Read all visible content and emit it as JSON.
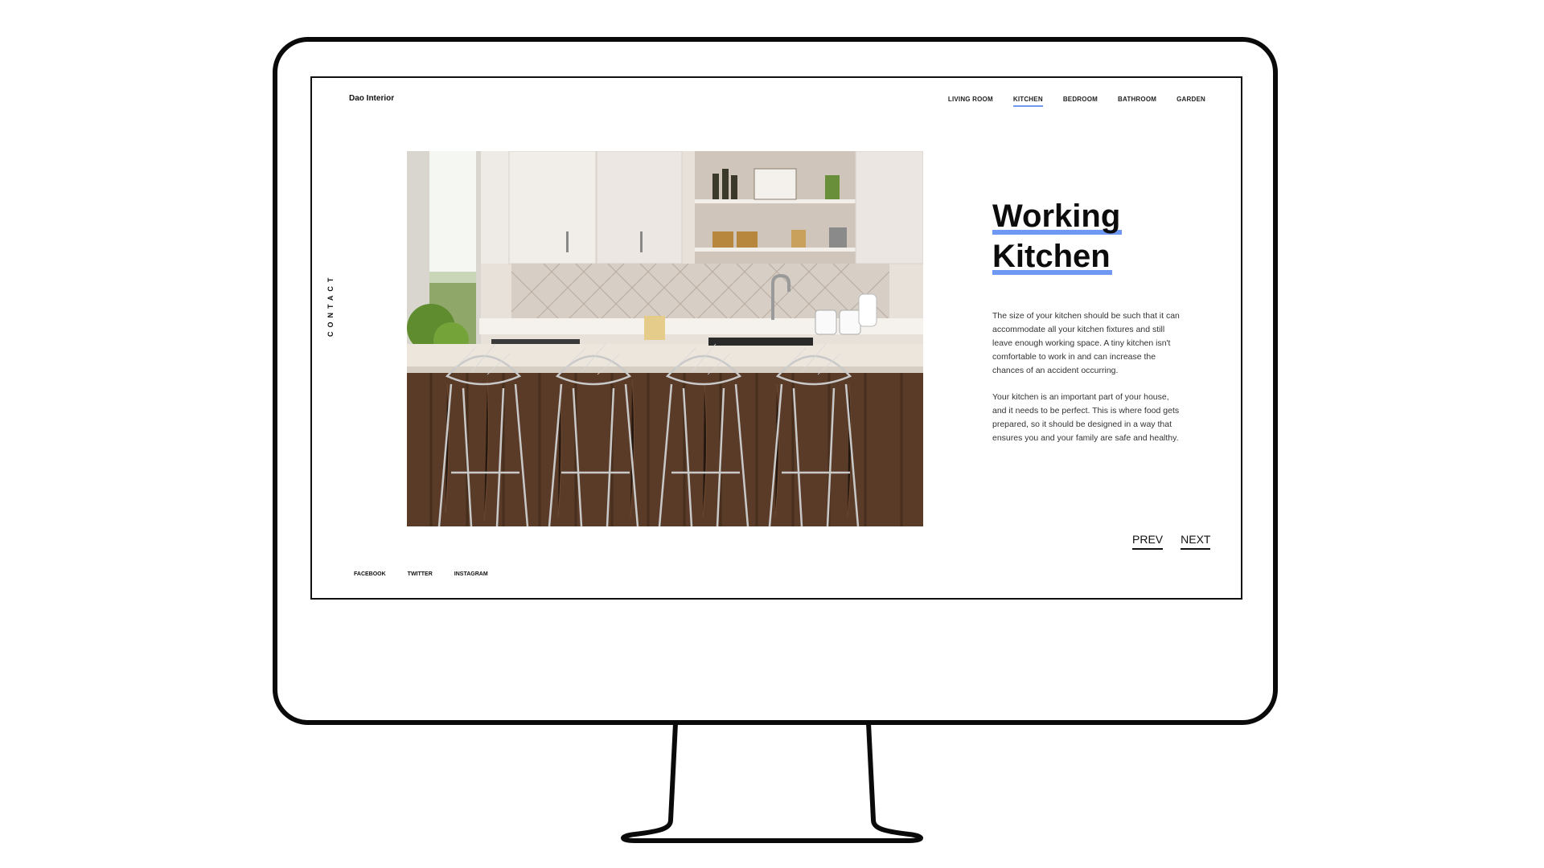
{
  "brand": "Dao Interior",
  "nav": {
    "items": [
      "LIVING ROOM",
      "KITCHEN",
      "BEDROOM",
      "BATHROOM",
      "GARDEN"
    ],
    "active": "KITCHEN"
  },
  "side_link": "CONTACT",
  "hero": {
    "title_line1": "Working",
    "title_line2": "Kitchen",
    "paragraph1": "The size of your kitchen should be such that it can accommodate all your kitchen fixtures and still leave enough working space. A tiny kitchen isn't comfortable to work in and can increase the chances of an accident occurring.",
    "paragraph2": "Your kitchen is an important part of your house, and it needs to be perfect. This is where food gets prepared, so it should be designed in a way that ensures you and your family are safe and healthy."
  },
  "pager": {
    "prev": "PREV",
    "next": "NEXT"
  },
  "social": [
    "FACEBOOK",
    "TWITTER",
    "INSTAGRAM"
  ],
  "colors": {
    "accent": "#6f98f2",
    "text": "#111111",
    "background": "#ffffff"
  },
  "icons": {
    "hero": "kitchen-photo"
  }
}
